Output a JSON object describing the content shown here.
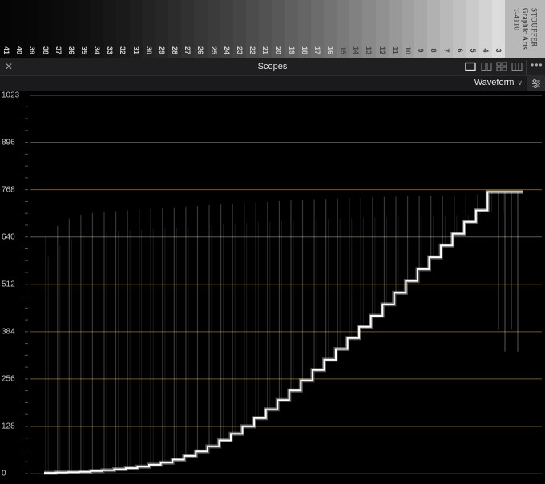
{
  "grayscale_strip": {
    "step_numbers": [
      "41",
      "40",
      "39",
      "38",
      "37",
      "36",
      "35",
      "34",
      "33",
      "32",
      "31",
      "30",
      "29",
      "28",
      "27",
      "26",
      "25",
      "24",
      "23",
      "22",
      "21",
      "20",
      "19",
      "18",
      "17",
      "16",
      "15",
      "14",
      "13",
      "12",
      "11",
      "10",
      "9",
      "8",
      "7",
      "6",
      "5",
      "4",
      "3"
    ],
    "label_lines": [
      "STOUFFER",
      "Graphic Arts",
      "T-4110"
    ]
  },
  "panel": {
    "title": "Scopes",
    "close_icon": "close-icon",
    "more_icon": "more-horizontal-icon",
    "layout_icons": [
      "layout-single-icon",
      "layout-split-icon",
      "layout-quad-icon",
      "layout-grid-icon"
    ]
  },
  "toolbar": {
    "scope_type": "Waveform",
    "settings_icon": "settings-sliders-icon"
  },
  "scope": {
    "y_ticks": [
      "1023",
      "896",
      "768",
      "640",
      "512",
      "384",
      "256",
      "128",
      "0"
    ],
    "colors": {
      "grid": "#6b5a22",
      "tick_label": "#c9c9c9",
      "trace": "#ffffff"
    }
  },
  "chart_data": {
    "type": "line",
    "title": "",
    "xlabel": "",
    "ylabel": "",
    "ylim": [
      0,
      1023
    ],
    "y_ticks": [
      0,
      128,
      256,
      384,
      512,
      640,
      768,
      896,
      1023
    ],
    "grid": true,
    "series": [
      {
        "name": "",
        "description_steps": 39,
        "values": [
          2,
          3,
          4,
          5,
          7,
          9,
          12,
          15,
          19,
          24,
          30,
          38,
          48,
          60,
          74,
          90,
          108,
          128,
          150,
          174,
          199,
          225,
          252,
          280,
          308,
          337,
          367,
          397,
          427,
          458,
          489,
          521,
          553,
          585,
          617,
          649,
          681,
          712,
          762,
          762,
          762
        ]
      },
      {
        "name": "",
        "values": [
          640,
          670,
          690,
          700,
          705,
          708,
          710,
          712,
          714,
          716,
          718,
          720,
          722,
          724,
          726,
          728,
          730,
          732,
          734,
          735,
          737,
          739,
          740,
          742,
          743,
          744,
          745,
          746,
          747,
          748,
          749,
          750,
          751,
          752,
          752,
          753,
          754,
          755,
          762,
          762,
          762
        ]
      }
    ]
  }
}
